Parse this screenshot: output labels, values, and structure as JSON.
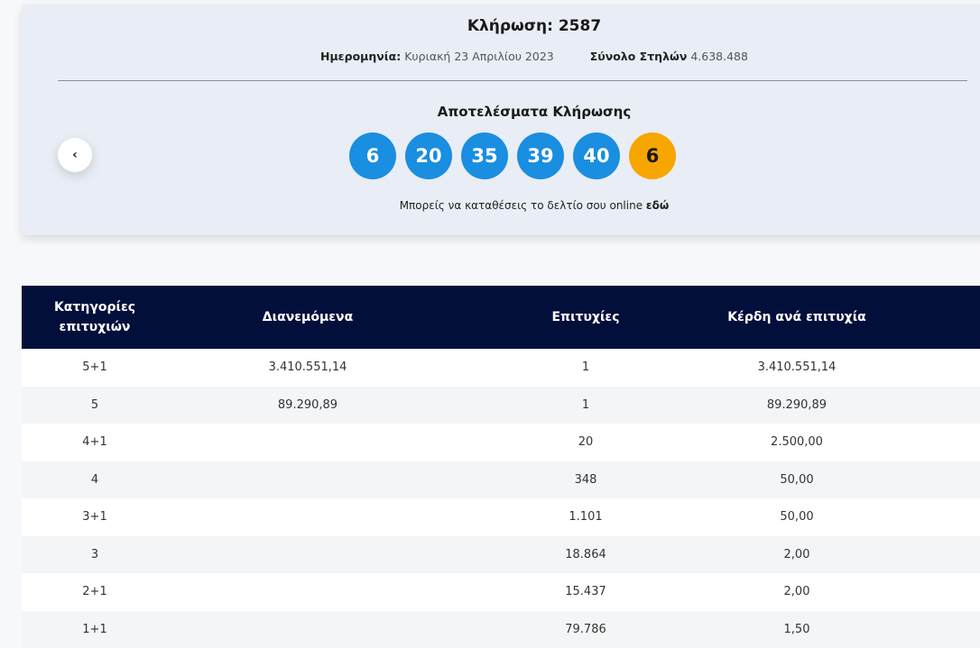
{
  "draw": {
    "title": "Κλήρωση: 2587",
    "date_label": "Ημερομηνία:",
    "date_value": "Κυριακή 23 Απριλίου 2023",
    "columns_label": "Σύνολο Στηλών",
    "columns_value": "4.638.488"
  },
  "results": {
    "heading": "Αποτελέσματα Κλήρωσης",
    "numbers": [
      "6",
      "20",
      "35",
      "39",
      "40"
    ],
    "bonus": "6",
    "online_text": "Μπορείς να καταθέσεις το δελτίο σου online",
    "online_link": "εδώ"
  },
  "nav": {
    "prev_icon": "chevron-left-icon",
    "prev_glyph": "‹"
  },
  "colors": {
    "ball": "#1a8ee0",
    "bonus": "#f7a600",
    "header": "#030f3b"
  },
  "table": {
    "headers": [
      "Κατηγορίες επιτυχιών",
      "Διανεμόμενα",
      "Επιτυχίες",
      "Κέρδη ανά επιτυχία"
    ],
    "rows": [
      [
        "5+1",
        "3.410.551,14",
        "1",
        "3.410.551,14"
      ],
      [
        "5",
        "89.290,89",
        "1",
        "89.290,89"
      ],
      [
        "4+1",
        "",
        "20",
        "2.500,00"
      ],
      [
        "4",
        "",
        "348",
        "50,00"
      ],
      [
        "3+1",
        "",
        "1.101",
        "50,00"
      ],
      [
        "3",
        "",
        "18.864",
        "2,00"
      ],
      [
        "2+1",
        "",
        "15.437",
        "2,00"
      ],
      [
        "1+1",
        "",
        "79.786",
        "1,50"
      ]
    ]
  }
}
